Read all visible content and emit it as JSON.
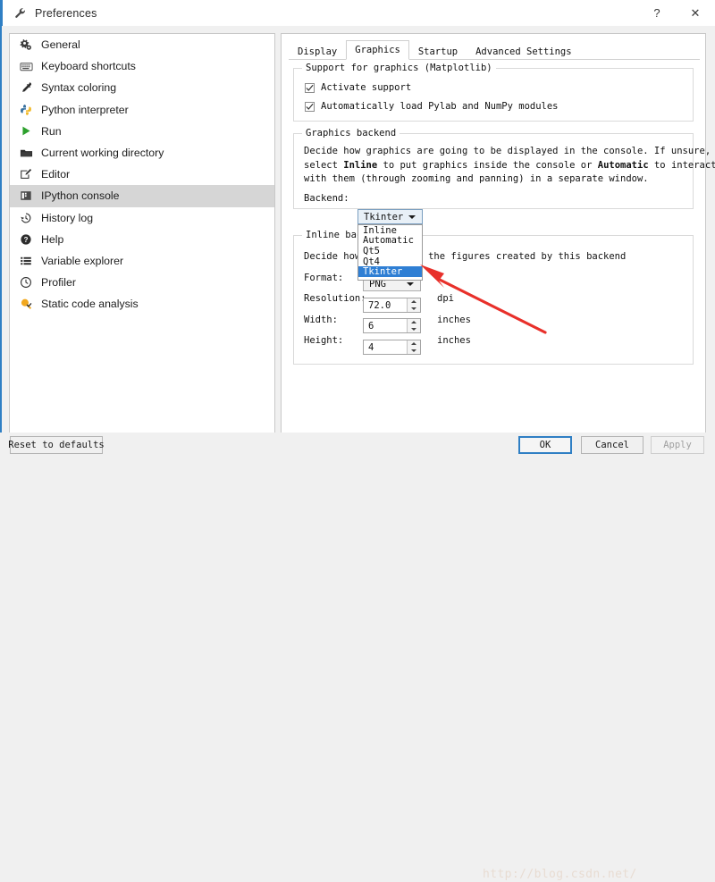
{
  "window": {
    "title": "Preferences",
    "help_btn": "?",
    "close_btn": "✕",
    "accent_color": "#2f7fc4"
  },
  "sidebar": {
    "items": [
      {
        "label": "General",
        "icon": "gears-icon",
        "selected": false
      },
      {
        "label": "Keyboard shortcuts",
        "icon": "keyboard-icon",
        "selected": false
      },
      {
        "label": "Syntax coloring",
        "icon": "eyedropper-icon",
        "selected": false
      },
      {
        "label": "Python interpreter",
        "icon": "python-icon",
        "selected": false
      },
      {
        "label": "Run",
        "icon": "play-icon",
        "selected": false
      },
      {
        "label": "Current working directory",
        "icon": "folder-icon",
        "selected": false
      },
      {
        "label": "Editor",
        "icon": "pencil-square-icon",
        "selected": false
      },
      {
        "label": "IPython console",
        "icon": "console-icon",
        "selected": true
      },
      {
        "label": "History log",
        "icon": "history-icon",
        "selected": false
      },
      {
        "label": "Help",
        "icon": "question-circle-icon",
        "selected": false
      },
      {
        "label": "Variable explorer",
        "icon": "list-icon",
        "selected": false
      },
      {
        "label": "Profiler",
        "icon": "clock-icon",
        "selected": false
      },
      {
        "label": "Static code analysis",
        "icon": "magnifier-check-icon",
        "selected": false
      }
    ]
  },
  "tabs": [
    {
      "label": "Display",
      "active": false
    },
    {
      "label": "Graphics",
      "active": true
    },
    {
      "label": "Startup",
      "active": false
    },
    {
      "label": "Advanced Settings",
      "active": false
    }
  ],
  "support_group": {
    "title": "Support for graphics (Matplotlib)",
    "checkboxes": [
      {
        "label": "Activate support",
        "checked": true
      },
      {
        "label": "Automatically load Pylab and NumPy modules",
        "checked": true
      }
    ]
  },
  "backend_group": {
    "title": "Graphics backend",
    "desc_line1_a": "Decide how graphics are going to be displayed in the console. If unsure, please",
    "desc_line2_a": "select ",
    "desc_line2_b": "Inline",
    "desc_line2_c": " to put graphics inside the console or ",
    "desc_line2_d": "Automatic",
    "desc_line2_e": " to interact",
    "desc_line3_a": "with them (through zooming and panning) in a separate window.",
    "backend_label": "Backend:",
    "backend_value": "Tkinter",
    "dropdown_options": [
      {
        "label": "Inline",
        "selected": false
      },
      {
        "label": "Automatic",
        "selected": false
      },
      {
        "label": "Qt5",
        "selected": false
      },
      {
        "label": "Qt4",
        "selected": false
      },
      {
        "label": "Tkinter",
        "selected": true
      }
    ],
    "dropdown_highlight_color": "#2f7fd4"
  },
  "inline_group": {
    "title": "Inline backend",
    "desc": "Decide how to display the figures created by this backend",
    "format_label": "Format:",
    "format_value": "PNG",
    "resolution_label": "Resolution:",
    "resolution_value": "72.0",
    "resolution_unit": "dpi",
    "width_label": "Width:",
    "width_value": "6",
    "width_unit": "inches",
    "height_label": "Height:",
    "height_value": "4",
    "height_unit": "inches"
  },
  "annotation": {
    "arrow_color": "#e8302a"
  },
  "footer": {
    "reset_label": "Reset to defaults",
    "ok_label": "OK",
    "cancel_label": "Cancel",
    "apply_label": "Apply",
    "watermark": "http://blog.csdn.net/"
  }
}
